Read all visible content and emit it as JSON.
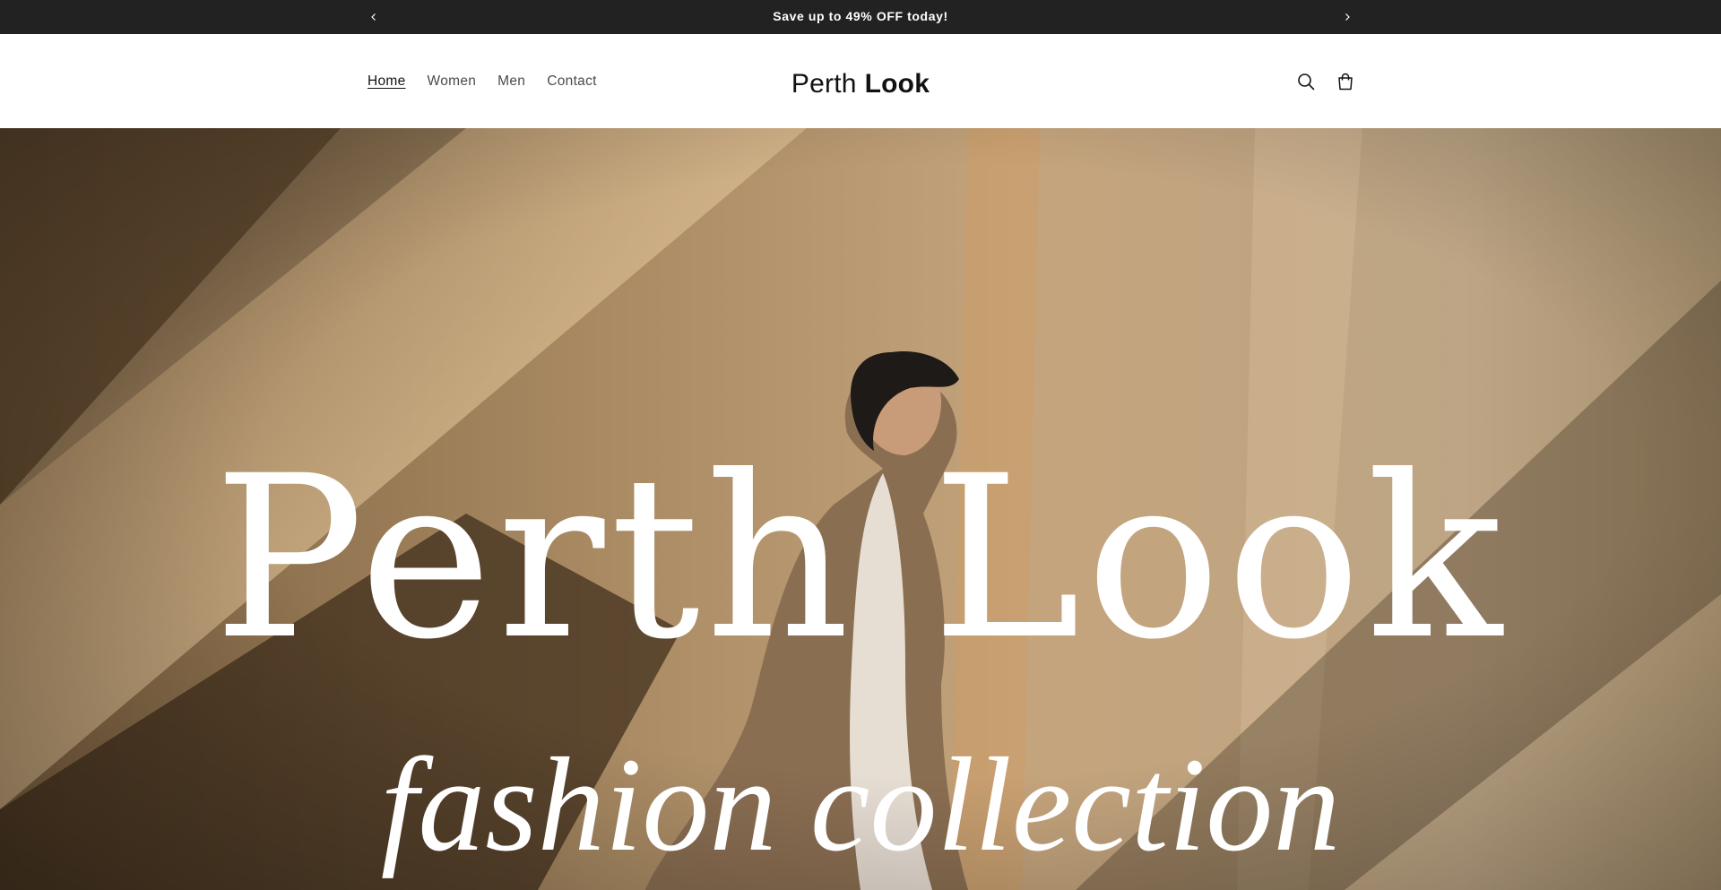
{
  "announcement": {
    "message": "Save up to 49% OFF today!",
    "prev_icon": "chevron-left-icon",
    "next_icon": "chevron-right-icon"
  },
  "header": {
    "nav": [
      {
        "label": "Home",
        "active": true
      },
      {
        "label": "Women",
        "active": false
      },
      {
        "label": "Men",
        "active": false
      },
      {
        "label": "Contact",
        "active": false
      }
    ],
    "logo": {
      "regular": "Perth",
      "bold": "Look"
    },
    "icons": [
      "search-icon",
      "cart-icon"
    ]
  },
  "hero": {
    "title": "Perth Look",
    "subtitle": "fashion collection"
  },
  "colors": {
    "announcement_bg": "#222222",
    "header_bg": "#ffffff",
    "text": "#121212",
    "hero_wall": "#b59872",
    "hero_text": "#ffffff"
  }
}
